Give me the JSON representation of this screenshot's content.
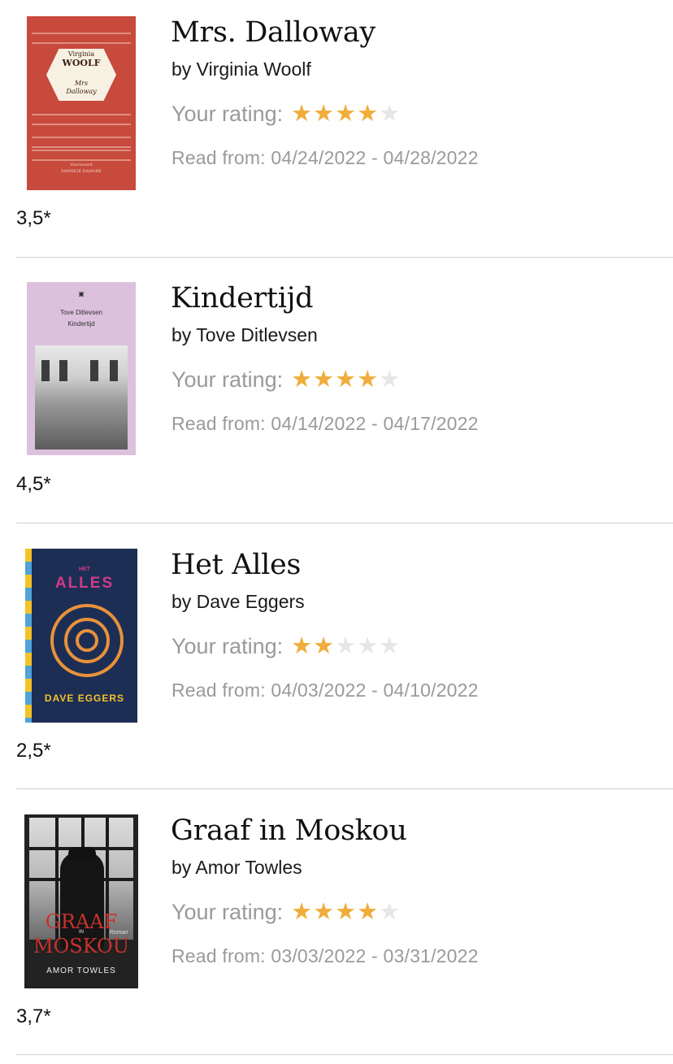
{
  "books": [
    {
      "title": "Mrs. Dalloway",
      "author": "by Virginia Woolf",
      "rating_label": "Your rating:",
      "rating": 4,
      "max_rating": 5,
      "read_label": "Read from: 04/24/2022 - 04/28/2022",
      "score": "3,5*",
      "cover_text": {
        "line1": "Virginia",
        "line2": "WOOLF",
        "line3": "Mrs",
        "line4": "Dalloway",
        "footer1": "Voorwoord",
        "footer2": "YANNICK DANGRE"
      }
    },
    {
      "title": "Kindertijd",
      "author": "by Tove Ditlevsen",
      "rating_label": "Your rating:",
      "rating": 4,
      "max_rating": 5,
      "read_label": "Read from: 04/14/2022 - 04/17/2022",
      "score": "4,5*",
      "cover_text": {
        "line1": "Tove Ditlevsen",
        "line2": "Kindertijd"
      }
    },
    {
      "title": "Het Alles",
      "author": "by Dave Eggers",
      "rating_label": "Your rating:",
      "rating": 2,
      "max_rating": 5,
      "read_label": "Read from: 04/03/2022 - 04/10/2022",
      "score": "2,5*",
      "cover_text": {
        "line1": "HET",
        "line2": "ALLES",
        "line3": "DAVE EGGERS"
      }
    },
    {
      "title": "Graaf in Moskou",
      "author": "by Amor Towles",
      "rating_label": "Your rating:",
      "rating": 4,
      "max_rating": 5,
      "read_label": "Read from: 03/03/2022 - 03/31/2022",
      "score": "3,7*",
      "cover_text": {
        "line1": "GRAAF",
        "line2": "IN",
        "line3": "MOSKOU",
        "line4": "Roman",
        "line5": "AMOR TOWLES"
      }
    }
  ],
  "colors": {
    "star_on": "#f0ad3b",
    "star_off": "#e6e6e6",
    "muted_text": "#9a9a9a",
    "divider": "#cfcfcf"
  }
}
